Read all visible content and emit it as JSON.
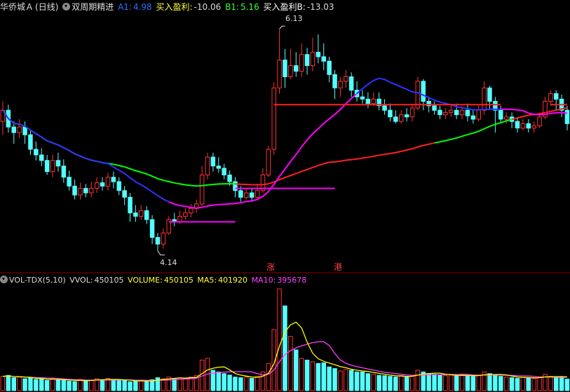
{
  "header": {
    "stock_name": "华侨城Ａ",
    "period": "(日线)",
    "indicator": "双周期精进",
    "a1_label": "A1:",
    "a1_value": "4.98",
    "buy_profit_label": "买入盈利:",
    "buy_profit_value": "-10.06",
    "b1_label": "B1:",
    "b1_value": "5.16",
    "buy_profit_b_label": "买入盈利B:",
    "buy_profit_b_value": "-13.03"
  },
  "volume_header": {
    "name": "VOL-TDX(5,10)",
    "vvol_label": "VVOL:",
    "vvol_value": "450105",
    "volume_label": "VOLUME:",
    "volume_value": "450105",
    "ma5_label": "MA5:",
    "ma5_value": "401920",
    "ma10_label": "MA10:",
    "ma10_value": "395678"
  },
  "annotations": {
    "high_label": "6.13",
    "low_label": "4.14",
    "marker_zhang": "涨",
    "marker_gang": "港"
  },
  "colors": {
    "up": "#ff3232",
    "down": "#54ffff",
    "ma_short": "#3030ff",
    "ma_mid": "#ff00ff",
    "ma_long_green": "#00ff00",
    "ma_long_red": "#ff2020",
    "yellow": "#ffff00",
    "white": "#dddddd"
  },
  "chart_data": {
    "type": "candlestick",
    "price_high": 6.13,
    "price_low": 4.14,
    "candles": [
      [
        5.3,
        5.4,
        5.48,
        5.18
      ],
      [
        5.4,
        5.25,
        5.45,
        5.2
      ],
      [
        5.25,
        5.2,
        5.3,
        5.1
      ],
      [
        5.2,
        5.25,
        5.32,
        5.15
      ],
      [
        5.25,
        5.18,
        5.3,
        5.1
      ],
      [
        5.18,
        5.05,
        5.22,
        5.0
      ],
      [
        5.05,
        5.0,
        5.12,
        4.95
      ],
      [
        5.0,
        4.95,
        5.06,
        4.9
      ],
      [
        4.95,
        4.85,
        5.0,
        4.82
      ],
      [
        4.85,
        4.95,
        5.0,
        4.8
      ],
      [
        4.95,
        4.9,
        5.02,
        4.85
      ],
      [
        4.9,
        4.8,
        4.96,
        4.75
      ],
      [
        4.8,
        4.72,
        4.86,
        4.68
      ],
      [
        4.72,
        4.64,
        4.78,
        4.6
      ],
      [
        4.64,
        4.7,
        4.75,
        4.6
      ],
      [
        4.7,
        4.66,
        4.74,
        4.62
      ],
      [
        4.66,
        4.7,
        4.76,
        4.62
      ],
      [
        4.7,
        4.75,
        4.8,
        4.66
      ],
      [
        4.75,
        4.72,
        4.8,
        4.68
      ],
      [
        4.72,
        4.8,
        4.84,
        4.68
      ],
      [
        4.8,
        4.76,
        4.85,
        4.7
      ],
      [
        4.76,
        4.68,
        4.8,
        4.64
      ],
      [
        4.68,
        4.62,
        4.72,
        4.55
      ],
      [
        4.62,
        4.48,
        4.66,
        4.4
      ],
      [
        4.48,
        4.45,
        4.55,
        4.4
      ],
      [
        4.45,
        4.5,
        4.55,
        4.42
      ],
      [
        4.5,
        4.42,
        4.54,
        4.38
      ],
      [
        4.42,
        4.26,
        4.46,
        4.2
      ],
      [
        4.26,
        4.2,
        4.3,
        4.14
      ],
      [
        4.2,
        4.3,
        4.34,
        4.16
      ],
      [
        4.3,
        4.42,
        4.45,
        4.28
      ],
      [
        4.42,
        4.4,
        4.48,
        4.36
      ],
      [
        4.4,
        4.45,
        4.5,
        4.38
      ],
      [
        4.45,
        4.48,
        4.52,
        4.42
      ],
      [
        4.48,
        4.52,
        4.56,
        4.44
      ],
      [
        4.52,
        4.56,
        4.6,
        4.48
      ],
      [
        4.56,
        4.82,
        4.9,
        4.54
      ],
      [
        4.82,
        4.98,
        5.02,
        4.78
      ],
      [
        4.98,
        4.9,
        5.02,
        4.85
      ],
      [
        4.9,
        4.88,
        4.98,
        4.84
      ],
      [
        4.88,
        4.82,
        4.92,
        4.78
      ],
      [
        4.82,
        4.76,
        4.86,
        4.72
      ],
      [
        4.76,
        4.68,
        4.8,
        4.62
      ],
      [
        4.68,
        4.62,
        4.72,
        4.58
      ],
      [
        4.62,
        4.66,
        4.7,
        4.6
      ],
      [
        4.66,
        4.62,
        4.7,
        4.58
      ],
      [
        4.62,
        4.68,
        4.74,
        4.6
      ],
      [
        4.68,
        4.82,
        4.88,
        4.66
      ],
      [
        4.82,
        5.05,
        5.08,
        4.8
      ],
      [
        5.05,
        5.6,
        5.65,
        5.0
      ],
      [
        5.6,
        5.85,
        6.13,
        5.55
      ],
      [
        5.85,
        5.7,
        5.95,
        5.6
      ],
      [
        5.7,
        5.8,
        5.95,
        5.68
      ],
      [
        5.8,
        5.75,
        5.92,
        5.7
      ],
      [
        5.75,
        5.9,
        6.0,
        5.7
      ],
      [
        5.9,
        5.8,
        5.96,
        5.72
      ],
      [
        5.8,
        5.92,
        6.05,
        5.75
      ],
      [
        5.92,
        5.88,
        6.08,
        5.82
      ],
      [
        5.88,
        5.84,
        6.0,
        5.76
      ],
      [
        5.84,
        5.72,
        5.88,
        5.65
      ],
      [
        5.72,
        5.6,
        5.76,
        5.5
      ],
      [
        5.6,
        5.66,
        5.7,
        5.52
      ],
      [
        5.66,
        5.7,
        5.76,
        5.6
      ],
      [
        5.7,
        5.58,
        5.74,
        5.52
      ],
      [
        5.58,
        5.52,
        5.66,
        5.48
      ],
      [
        5.52,
        5.5,
        5.58,
        5.46
      ],
      [
        5.5,
        5.46,
        5.56,
        5.42
      ],
      [
        5.46,
        5.5,
        5.56,
        5.44
      ],
      [
        5.5,
        5.44,
        5.56,
        5.4
      ],
      [
        5.44,
        5.4,
        5.5,
        5.36
      ],
      [
        5.4,
        5.34,
        5.46,
        5.3
      ],
      [
        5.34,
        5.3,
        5.4,
        5.28
      ],
      [
        5.3,
        5.36,
        5.4,
        5.28
      ],
      [
        5.36,
        5.34,
        5.42,
        5.3
      ],
      [
        5.34,
        5.42,
        5.46,
        5.3
      ],
      [
        5.42,
        5.66,
        5.7,
        5.4
      ],
      [
        5.66,
        5.48,
        5.68,
        5.4
      ],
      [
        5.48,
        5.44,
        5.52,
        5.38
      ],
      [
        5.44,
        5.4,
        5.48,
        5.36
      ],
      [
        5.4,
        5.36,
        5.44,
        5.32
      ],
      [
        5.36,
        5.38,
        5.42,
        5.32
      ],
      [
        5.38,
        5.4,
        5.46,
        5.34
      ],
      [
        5.4,
        5.36,
        5.46,
        5.32
      ],
      [
        5.36,
        5.4,
        5.44,
        5.32
      ],
      [
        5.4,
        5.35,
        5.46,
        5.3
      ],
      [
        5.35,
        5.32,
        5.4,
        5.28
      ],
      [
        5.32,
        5.4,
        5.44,
        5.3
      ],
      [
        5.4,
        5.6,
        5.66,
        5.36
      ],
      [
        5.6,
        5.48,
        5.62,
        5.4
      ],
      [
        5.48,
        5.4,
        5.52,
        5.2
      ],
      [
        5.4,
        5.32,
        5.44,
        5.28
      ],
      [
        5.32,
        5.34,
        5.38,
        5.28
      ],
      [
        5.34,
        5.3,
        5.38,
        5.24
      ],
      [
        5.3,
        5.24,
        5.34,
        5.2
      ],
      [
        5.24,
        5.28,
        5.32,
        5.22
      ],
      [
        5.28,
        5.24,
        5.32,
        5.2
      ],
      [
        5.24,
        5.26,
        5.3,
        5.2
      ],
      [
        5.26,
        5.34,
        5.38,
        5.24
      ],
      [
        5.34,
        5.48,
        5.52,
        5.32
      ],
      [
        5.48,
        5.55,
        5.58,
        5.44
      ],
      [
        5.55,
        5.5,
        5.58,
        5.4
      ],
      [
        5.5,
        5.4,
        5.54,
        5.34
      ],
      [
        5.4,
        5.28,
        5.44,
        5.22
      ]
    ],
    "volume": [
      42,
      45,
      38,
      40,
      35,
      37,
      33,
      34,
      30,
      36,
      32,
      30,
      28,
      27,
      33,
      30,
      31,
      35,
      31,
      36,
      33,
      29,
      30,
      26,
      28,
      30,
      27,
      32,
      38,
      35,
      40,
      36,
      38,
      35,
      40,
      45,
      90,
      95,
      60,
      55,
      50,
      46,
      40,
      38,
      40,
      36,
      42,
      55,
      80,
      180,
      300,
      250,
      160,
      120,
      95,
      90,
      85,
      80,
      82,
      70,
      65,
      58,
      62,
      60,
      55,
      55,
      50,
      48,
      45,
      44,
      42,
      40,
      44,
      40,
      45,
      60,
      55,
      50,
      48,
      45,
      44,
      46,
      43,
      46,
      44,
      42,
      46,
      55,
      50,
      45,
      42,
      40,
      38,
      36,
      40,
      38,
      36,
      40,
      48,
      42,
      40,
      38,
      34
    ]
  }
}
